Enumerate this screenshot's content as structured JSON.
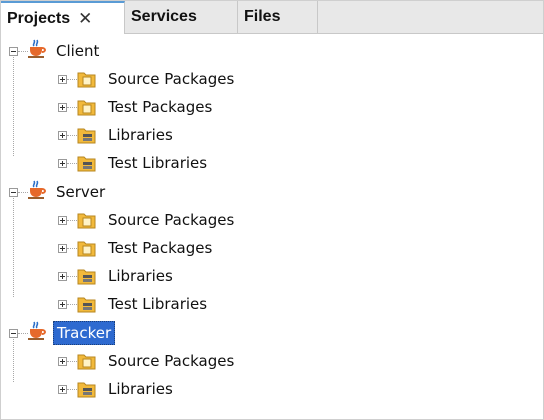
{
  "tabs": [
    {
      "label": "Projects",
      "close": "✕",
      "active": true
    },
    {
      "label": "Services"
    },
    {
      "label": "Files"
    }
  ],
  "tree": [
    {
      "name": "Client",
      "children": [
        "Source Packages",
        "Test Packages",
        "Libraries",
        "Test Libraries"
      ]
    },
    {
      "name": "Server",
      "children": [
        "Source Packages",
        "Test Packages",
        "Libraries",
        "Test Libraries"
      ]
    },
    {
      "name": "Tracker",
      "selected": true,
      "children": [
        "Source Packages",
        "Libraries"
      ]
    }
  ]
}
